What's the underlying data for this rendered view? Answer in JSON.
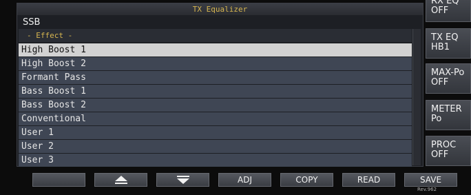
{
  "panel": {
    "title": "TX Equalizer",
    "mode": "SSB",
    "list_header": "- Effect -",
    "items": [
      "High Boost 1",
      "High Boost 2",
      "Formant Pass",
      "Bass Boost 1",
      "Bass Boost 2",
      "Conventional",
      "User 1",
      "User 2",
      "User 3"
    ],
    "selected_item": "High Boost 1"
  },
  "side_keys": [
    {
      "line1": "RX EQ",
      "line2": "OFF"
    },
    {
      "line1": "TX EQ",
      "line2": "HB1"
    },
    {
      "line1": "MAX-Po",
      "line2": "OFF"
    },
    {
      "line1": "METER",
      "line2": "Po"
    },
    {
      "line1": "PROC",
      "line2": "OFF"
    }
  ],
  "bottom_keys": {
    "f1": "",
    "up_icon": "up-arrow-icon",
    "down_icon": "down-arrow-icon",
    "adj": "ADJ",
    "copy": "COPY",
    "read": "READ",
    "save": "SAVE"
  },
  "revision": "Rev.962",
  "colors": {
    "title_text": "#d7b650",
    "row_bg": "#3f4654",
    "selected_row_bg": "#d2d2d2"
  }
}
